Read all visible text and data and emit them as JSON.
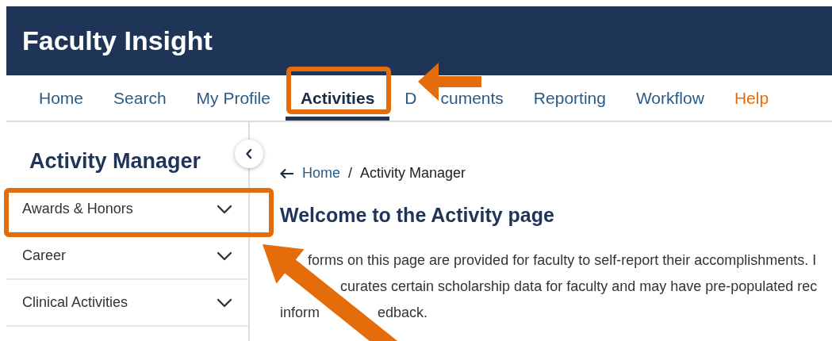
{
  "header": {
    "title": "Faculty Insight"
  },
  "tabs": [
    {
      "label": "Home",
      "selected": false,
      "color": "#2b5a84"
    },
    {
      "label": "Search",
      "selected": false,
      "color": "#2b5a84"
    },
    {
      "label": "My Profile",
      "selected": false,
      "color": "#2b5a84"
    },
    {
      "label": "Activities",
      "selected": true,
      "color": "#1c2b45"
    },
    {
      "label": "D",
      "label_continued": "cuments",
      "selected": false,
      "color": "#2b5a84"
    },
    {
      "label": "Reporting",
      "selected": false,
      "color": "#2b5a84"
    },
    {
      "label": "Workflow",
      "selected": false,
      "color": "#2b5a84"
    },
    {
      "label": "Help",
      "selected": false,
      "color": "#e46c0a"
    }
  ],
  "sidebar": {
    "title": "Activity Manager",
    "items": [
      "Awards & Honors",
      "Career",
      "Clinical Activities"
    ]
  },
  "breadcrumb": {
    "link": "Home",
    "separator": "/",
    "current": "Activity Manager"
  },
  "content": {
    "title": "Welcome to the Activity page",
    "paragraph_lines": [
      [
        "forms on this page are provided for faculty to self-report their accomplishments. I"
      ],
      [
        "curates certain scholarship data for faculty and may have pre-populated rec"
      ],
      [
        "inform",
        "edback."
      ]
    ]
  }
}
